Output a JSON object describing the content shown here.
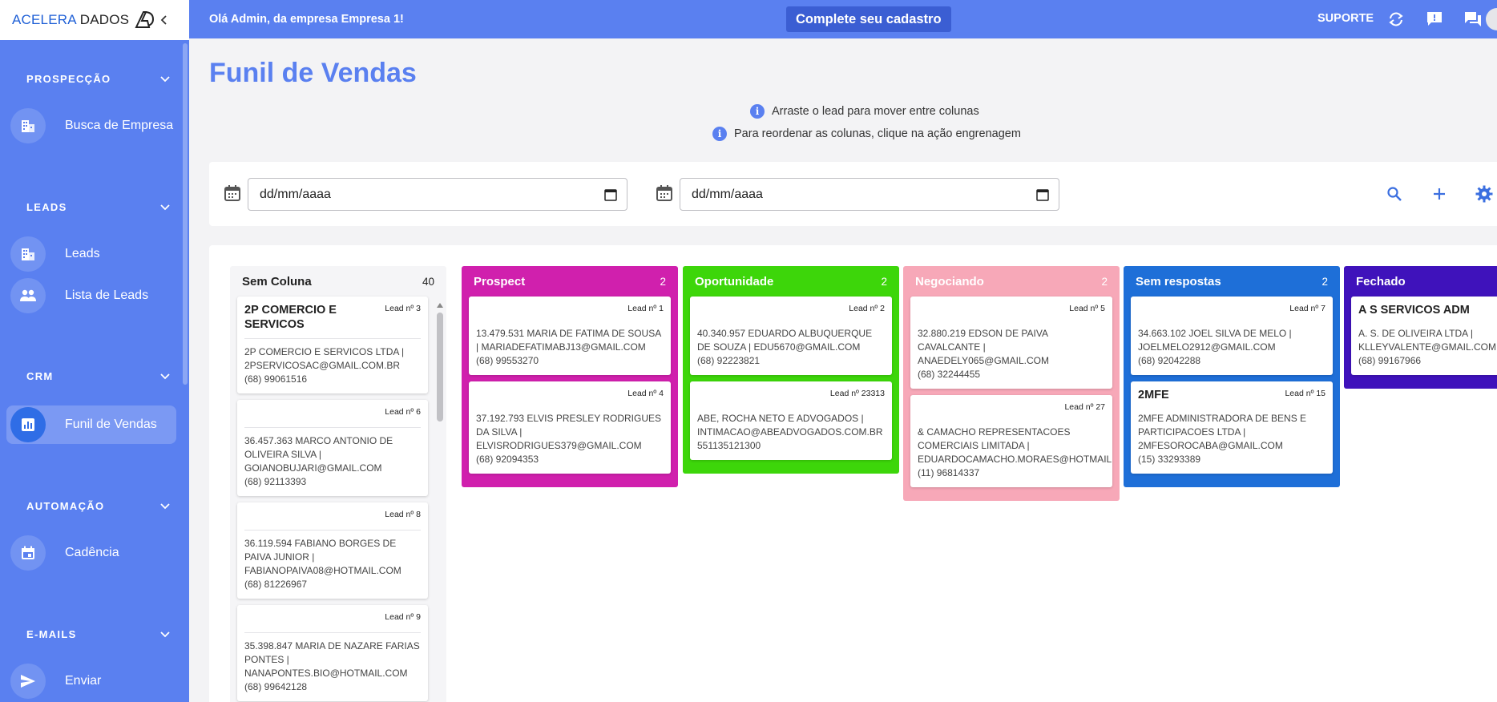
{
  "logo": {
    "brand_blue": "ACELERA",
    "brand_dark": "DADOS",
    "mark": "AD-logo-icon"
  },
  "sidebar": {
    "sections": [
      {
        "title": "PROSPECÇÃO",
        "items": [
          {
            "label": "Busca de Empresa",
            "icon": "building-icon"
          }
        ]
      },
      {
        "title": "LEADS",
        "items": [
          {
            "label": "Leads",
            "icon": "building-icon"
          },
          {
            "label": "Lista de Leads",
            "icon": "people-icon"
          }
        ]
      },
      {
        "title": "CRM",
        "items": [
          {
            "label": "Funil de Vendas",
            "icon": "chart-icon",
            "active": true
          }
        ]
      },
      {
        "title": "AUTOMAÇÃO",
        "items": [
          {
            "label": "Cadência",
            "icon": "calendar-icon"
          }
        ]
      },
      {
        "title": "E-MAILS",
        "items": [
          {
            "label": "Enviar",
            "icon": "send-icon"
          }
        ]
      }
    ]
  },
  "topbar": {
    "greeting": "Olá Admin, da empresa Empresa 1!",
    "complete_button": "Complete seu cadastro",
    "support": "SUPORTE"
  },
  "page": {
    "title": "Funil de Vendas",
    "info1": "Arraste o lead para mover entre colunas",
    "info2": "Para reordenar as colunas, clique na ação engrenagem",
    "date_start": {
      "placeholder": "dd/mm/aaaa"
    },
    "date_end": {
      "placeholder": "dd/mm/aaaa"
    }
  },
  "colors": {
    "primary": "#5a80f0",
    "sem_coluna": "#f5f5f7",
    "prospect": "#d020ad",
    "oportunidade": "#3dd60a",
    "negociando": "#f7a8b8",
    "sem_respostas": "#1e6fd8",
    "fechado": "#3f12bb"
  },
  "columns": [
    {
      "name": "Sem Coluna",
      "count": "40",
      "cards": [
        {
          "name": "2P COMERCIO E SERVICOS",
          "lead": "Lead nº 3",
          "info": "2P COMERCIO E SERVICOS LTDA | 2PSERVICOSAC@GMAIL.COM.BR",
          "phone": "(68) 99061516"
        },
        {
          "name": "",
          "lead": "Lead nº 6",
          "info": "36.457.363 MARCO ANTONIO DE OLIVEIRA SILVA | GOIANOBUJARI@GMAIL.COM",
          "phone": "(68) 92113393"
        },
        {
          "name": "",
          "lead": "Lead nº 8",
          "info": "36.119.594 FABIANO BORGES DE PAIVA JUNIOR | FABIANOPAIVA08@HOTMAIL.COM",
          "phone": "(68) 81226967"
        },
        {
          "name": "",
          "lead": "Lead nº 9",
          "info": "35.398.847 MARIA DE NAZARE FARIAS PONTES | NANAPONTES.BIO@HOTMAIL.COM",
          "phone": "(68) 99642128"
        }
      ]
    },
    {
      "name": "Prospect",
      "count": "2",
      "cards": [
        {
          "name": "",
          "lead": "Lead nº 1",
          "info": "13.479.531 MARIA DE FATIMA DE SOUSA | MARIADEFATIMABJ13@GMAIL.COM",
          "phone": "(68) 99553270"
        },
        {
          "name": "",
          "lead": "Lead nº 4",
          "info": "37.192.793 ELVIS PRESLEY RODRIGUES DA SILVA | ELVISRODRIGUES379@GMAIL.COM",
          "phone": "(68) 92094353"
        }
      ]
    },
    {
      "name": "Oportunidade",
      "count": "2",
      "cards": [
        {
          "name": "",
          "lead": "Lead nº 2",
          "info": "40.340.957 EDUARDO ALBUQUERQUE DE SOUZA | EDU5670@GMAIL.COM",
          "phone": "(68) 92223821"
        },
        {
          "name": "",
          "lead": "Lead nº 23313",
          "info": "ABE, ROCHA NETO E ADVOGADOS | INTIMACAO@ABEADVOGADOS.COM.BR",
          "phone": "551135121300"
        }
      ]
    },
    {
      "name": "Negociando",
      "count": "2",
      "cards": [
        {
          "name": "",
          "lead": "Lead nº 5",
          "info": "32.880.219 EDSON DE PAIVA CAVALCANTE | ANAEDELY065@GMAIL.COM",
          "phone": "(68) 32244455"
        },
        {
          "name": "",
          "lead": "Lead nº 27",
          "info": "& CAMACHO REPRESENTACOES COMERCIAIS LIMITADA | EDUARDOCAMACHO.MORAES@HOTMAIL.C",
          "phone": "(11) 96814337"
        }
      ]
    },
    {
      "name": "Sem respostas",
      "count": "2",
      "cards": [
        {
          "name": "",
          "lead": "Lead nº 7",
          "info": "34.663.102 JOEL SILVA DE MELO | JOELMELO2912@GMAIL.COM",
          "phone": "(68) 92042288"
        },
        {
          "name": "2MFE",
          "lead": "Lead nº 15",
          "info": "2MFE ADMINISTRADORA DE BENS E PARTICIPACOES LTDA | 2MFESOROCABA@GMAIL.COM",
          "phone": "(15) 33293389"
        }
      ]
    },
    {
      "name": "Fechado",
      "count": "",
      "cards": [
        {
          "name": "A S SERVICOS ADM",
          "lead": "",
          "info": "A. S. DE OLIVEIRA LTDA | KLLEYVALENTE@GMAIL.COM",
          "phone": "(68) 99167966"
        }
      ]
    }
  ]
}
